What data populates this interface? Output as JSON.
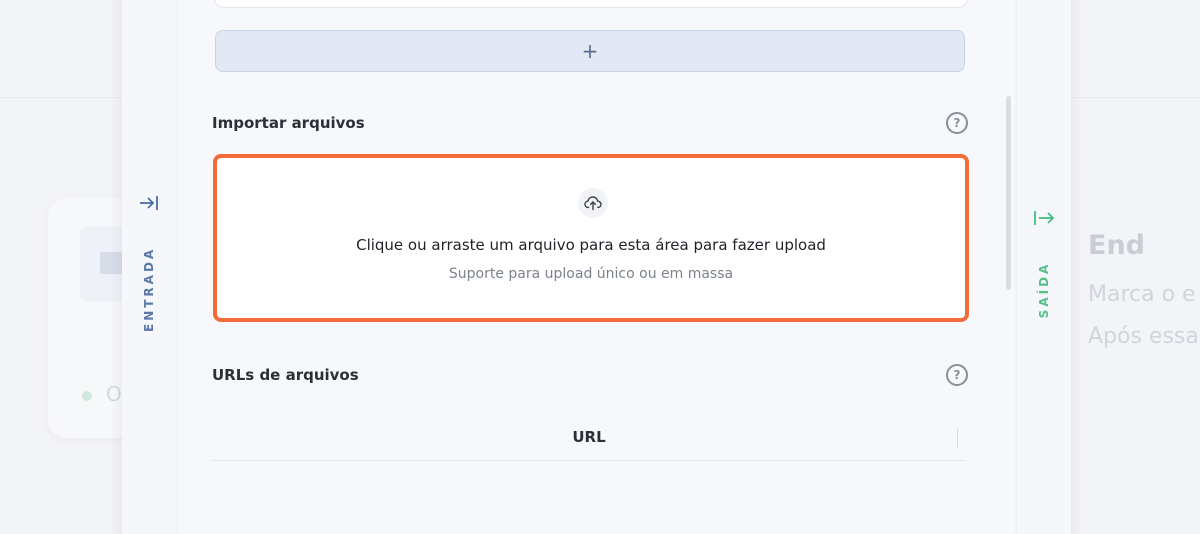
{
  "background": {
    "left_card_text": "O",
    "right_card": {
      "title": "End",
      "line1": "Marca o e",
      "line2": "Após essa"
    }
  },
  "side_left": {
    "label": "ENTRADA",
    "icon": "arrow-to-right-bar-icon",
    "color": "#4a6fa5"
  },
  "side_right": {
    "label": "SAÍDA",
    "icon": "arrow-exit-right-icon",
    "color": "#3fbf7f"
  },
  "panel": {
    "add_button_label": "+",
    "import_section": {
      "title": "Importar arquivos",
      "help_icon": "question-circle-icon",
      "upload": {
        "icon": "cloud-upload-icon",
        "main_text": "Clique ou arraste um arquivo para esta área para fazer upload",
        "hint_text": "Suporte para upload único ou em massa",
        "border_color": "#f26b3a"
      }
    },
    "urls_section": {
      "title": "URLs de arquivos",
      "help_icon": "question-circle-icon",
      "table": {
        "columns": [
          "URL"
        ]
      }
    }
  }
}
